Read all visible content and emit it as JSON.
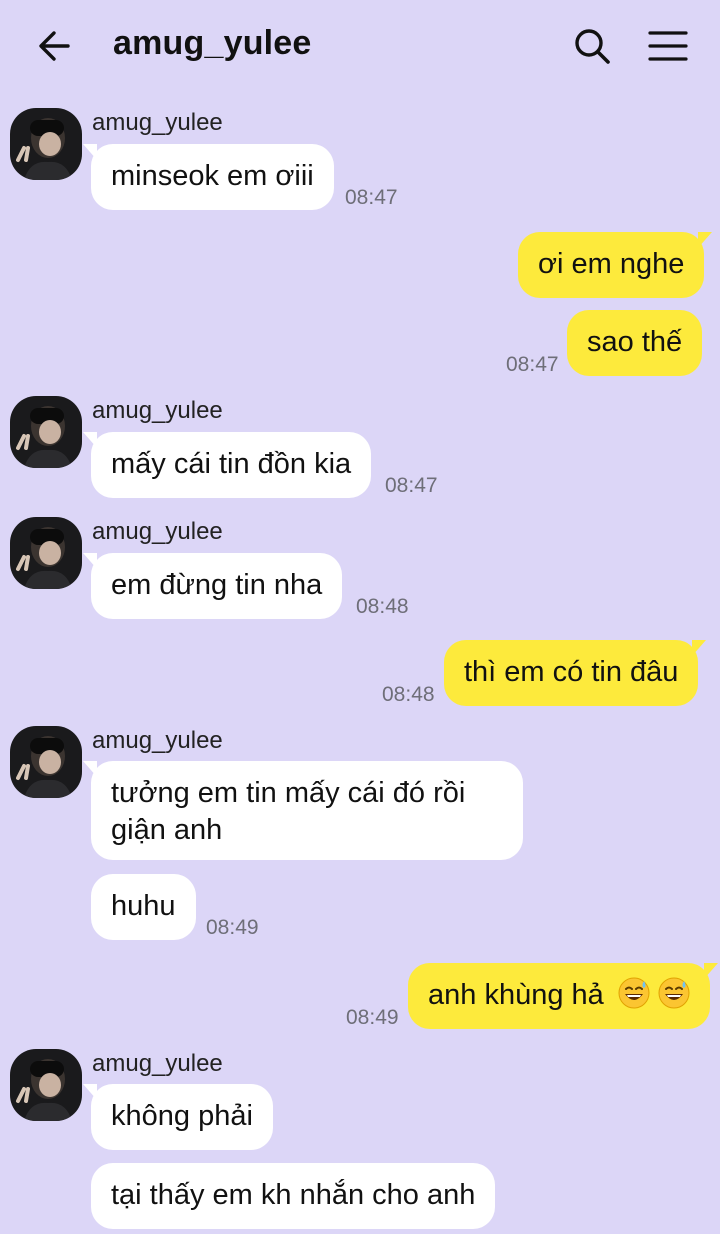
{
  "header": {
    "title": "amug_yulee",
    "back_icon": "arrow-left-icon",
    "search_icon": "search-icon",
    "menu_icon": "hamburger-menu-icon"
  },
  "contact_name": "amug_yulee",
  "messages": [
    {
      "text": "minseok em ơiii",
      "time": "08:47"
    },
    {
      "text": "ơi em nghe"
    },
    {
      "text": "sao thế",
      "time": "08:47"
    },
    {
      "text": "mấy cái tin đồn kia",
      "time": "08:47"
    },
    {
      "text": "em đừng tin nha",
      "time": "08:48"
    },
    {
      "text": "thì em có tin đâu",
      "time": "08:48"
    },
    {
      "text": "tưởng em tin mấy cái đó rồi giận anh"
    },
    {
      "text": "huhu",
      "time": "08:49"
    },
    {
      "text": "anh khùng hả",
      "time": "08:49",
      "emoji": "😅😅"
    },
    {
      "text": "không phải"
    },
    {
      "text": "tại thấy em kh nhắn cho anh"
    }
  ],
  "colors": {
    "background": "#dcd6f7",
    "incoming_bubble": "#ffffff",
    "outgoing_bubble": "#fdea3c",
    "time_text": "#6e6e78"
  }
}
